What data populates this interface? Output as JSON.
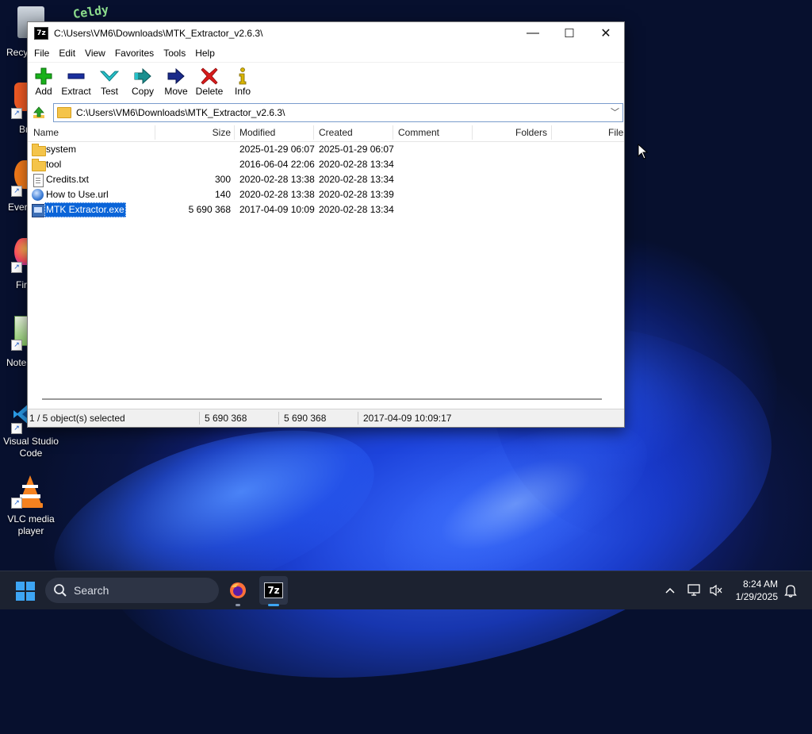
{
  "desktop": {
    "icons": [
      {
        "label": "Recy"
      },
      {
        "label": "Br"
      },
      {
        "label": "Ever"
      },
      {
        "label": "Fir"
      },
      {
        "label": "Note"
      },
      {
        "label": "Visual Studio Code"
      },
      {
        "label": "VLC media player"
      }
    ],
    "top_logo": "Celdy"
  },
  "window": {
    "title": "C:\\Users\\VM6\\Downloads\\MTK_Extractor_v2.6.3\\",
    "app_icon_text": "7z",
    "minimize": "—",
    "maximize": "☐",
    "close": "✕"
  },
  "menu": [
    "File",
    "Edit",
    "View",
    "Favorites",
    "Tools",
    "Help"
  ],
  "toolbar": [
    {
      "label": "Add",
      "icon": "add-icon",
      "color": "#18b11a"
    },
    {
      "label": "Extract",
      "icon": "extract-icon",
      "color": "#1a2f9e"
    },
    {
      "label": "Test",
      "icon": "test-icon",
      "color": "#27c1c9"
    },
    {
      "label": "Copy",
      "icon": "copy-icon",
      "color": "#1a8f8f"
    },
    {
      "label": "Move",
      "icon": "move-icon",
      "color": "#1a2a8a"
    },
    {
      "label": "Delete",
      "icon": "delete-icon",
      "color": "#d81b1b"
    },
    {
      "label": "Info",
      "icon": "info-icon",
      "color": "#d8b400"
    }
  ],
  "address": {
    "path": "C:\\Users\\VM6\\Downloads\\MTK_Extractor_v2.6.3\\"
  },
  "columns": [
    "Name",
    "Size",
    "Modified",
    "Created",
    "Comment",
    "Folders",
    "File"
  ],
  "files": [
    {
      "name": "system",
      "type": "folder",
      "size": "",
      "modified": "2025-01-29 06:07",
      "created": "2025-01-29 06:07"
    },
    {
      "name": "tool",
      "type": "folder",
      "size": "",
      "modified": "2016-06-04 22:06",
      "created": "2020-02-28 13:34"
    },
    {
      "name": "Credits.txt",
      "type": "txt",
      "size": "300",
      "modified": "2020-02-28 13:38",
      "created": "2020-02-28 13:34"
    },
    {
      "name": "How to Use.url",
      "type": "url",
      "size": "140",
      "modified": "2020-02-28 13:38",
      "created": "2020-02-28 13:39"
    },
    {
      "name": "MTK Extractor.exe",
      "type": "exe",
      "size": "5 690 368",
      "modified": "2017-04-09 10:09",
      "created": "2020-02-28 13:34",
      "selected": true
    }
  ],
  "status": {
    "selection": "1 / 5 object(s) selected",
    "size": "5 690 368",
    "packed": "5 690 368",
    "date": "2017-04-09 10:09:17"
  },
  "taskbar": {
    "search_label": "Search",
    "app_7z": "7z",
    "time": "8:24 AM",
    "date": "1/29/2025",
    "accent": "#3da5f4"
  }
}
